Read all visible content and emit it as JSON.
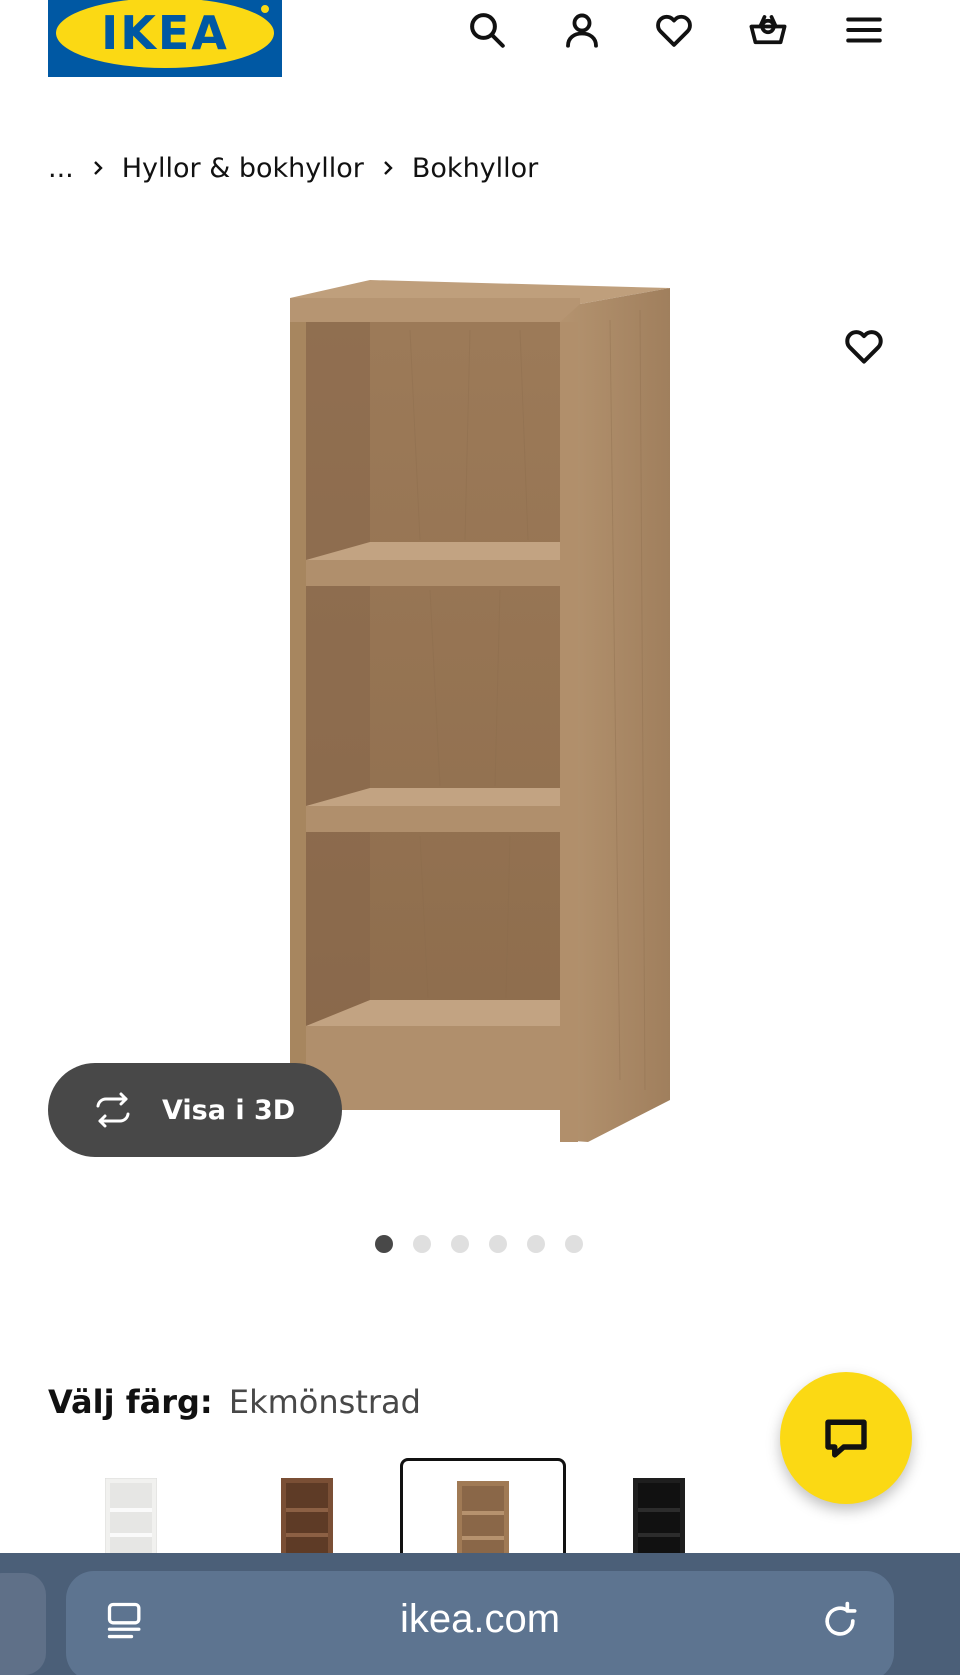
{
  "brand": {
    "logo_text": "IKEA"
  },
  "header": {
    "icons": [
      "search-icon",
      "account-icon",
      "favorites-icon",
      "cart-icon",
      "menu-icon"
    ]
  },
  "breadcrumb": {
    "ellipsis": "...",
    "items": [
      "Hyllor & bokhyllor",
      "Bokhyllor"
    ]
  },
  "product": {
    "view3d_label": "Visa i 3D",
    "image_count": 6,
    "active_image": 1
  },
  "color": {
    "label": "Välj färg:",
    "selected_value": "Ekmönstrad",
    "swatches": [
      {
        "color": "#f4f4f2",
        "selected": false
      },
      {
        "color": "#7a4f35",
        "selected": false
      },
      {
        "color": "#a07a55",
        "selected": true
      },
      {
        "color": "#1e1e1e",
        "selected": false
      }
    ]
  },
  "colors": {
    "ikea_blue": "#0058A3",
    "ikea_yellow": "#FBD914",
    "wood": "#a98a6a",
    "browser_bar": "#4b5f78"
  },
  "browser": {
    "url": "ikea.com"
  }
}
